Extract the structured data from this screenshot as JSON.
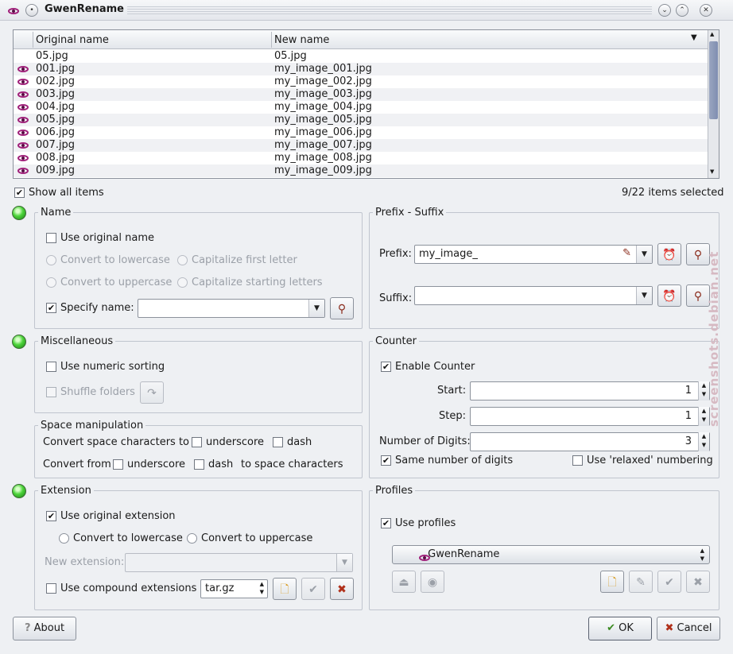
{
  "window": {
    "title": "GwenRename",
    "titlebar_menu_icon": "pin-icon",
    "minimize_icon": "chevron-down-icon",
    "maximize_icon": "chevron-up-icon"
  },
  "list": {
    "columns": [
      "Original name",
      "New name"
    ],
    "rows": [
      {
        "orig": "05.jpg",
        "new": "05.jpg",
        "icon": false
      },
      {
        "orig": "001.jpg",
        "new": "my_image_001.jpg",
        "icon": true
      },
      {
        "orig": "002.jpg",
        "new": "my_image_002.jpg",
        "icon": true
      },
      {
        "orig": "003.jpg",
        "new": "my_image_003.jpg",
        "icon": true
      },
      {
        "orig": "004.jpg",
        "new": "my_image_004.jpg",
        "icon": true
      },
      {
        "orig": "005.jpg",
        "new": "my_image_005.jpg",
        "icon": true
      },
      {
        "orig": "006.jpg",
        "new": "my_image_006.jpg",
        "icon": true
      },
      {
        "orig": "007.jpg",
        "new": "my_image_007.jpg",
        "icon": true
      },
      {
        "orig": "008.jpg",
        "new": "my_image_008.jpg",
        "icon": true
      },
      {
        "orig": "009.jpg",
        "new": "my_image_009.jpg",
        "icon": true
      }
    ],
    "show_all_label": "Show all items",
    "show_all_checked": true,
    "selection_status": "9/22 items selected"
  },
  "name_group": {
    "title": "Name",
    "use_original_label": "Use original name",
    "lowercase_label": "Convert to lowercase",
    "capitalize_first_label": "Capitalize first letter",
    "uppercase_label": "Convert to uppercase",
    "capitalize_words_label": "Capitalize starting letters",
    "specify_label": "Specify name:",
    "specify_value": ""
  },
  "prefix_group": {
    "title": "Prefix - Suffix",
    "prefix_label": "Prefix:",
    "prefix_value": "my_image_",
    "suffix_label": "Suffix:",
    "suffix_value": ""
  },
  "misc_group": {
    "title": "Miscellaneous",
    "numeric_sorting_label": "Use numeric sorting",
    "shuffle_label": "Shuffle folders"
  },
  "space_group": {
    "title": "Space manipulation",
    "convert_to_label": "Convert space characters to",
    "convert_from_label": "Convert from",
    "to_space_label": "to space characters",
    "underscore_label": "underscore",
    "dash_label": "dash"
  },
  "counter_group": {
    "title": "Counter",
    "enable_label": "Enable Counter",
    "start_label": "Start:",
    "start_value": "1",
    "step_label": "Step:",
    "step_value": "1",
    "digits_label": "Number of Digits:",
    "digits_value": "3",
    "same_digits_label": "Same number of digits",
    "relaxed_label": "Use 'relaxed' numbering"
  },
  "extension_group": {
    "title": "Extension",
    "use_original_label": "Use original extension",
    "lowercase_label": "Convert to lowercase",
    "uppercase_label": "Convert to uppercase",
    "new_ext_label": "New extension:",
    "compound_label": "Use compound extensions",
    "compound_value": "tar.gz"
  },
  "profiles_group": {
    "title": "Profiles",
    "use_profiles_label": "Use profiles",
    "profile_value": "GwenRename"
  },
  "buttons": {
    "about": "About",
    "ok": "OK",
    "cancel": "Cancel"
  },
  "watermark": "screenshots.debian.net",
  "colors": {
    "accent": "#a0207a",
    "led_green": "#4cd43a"
  }
}
